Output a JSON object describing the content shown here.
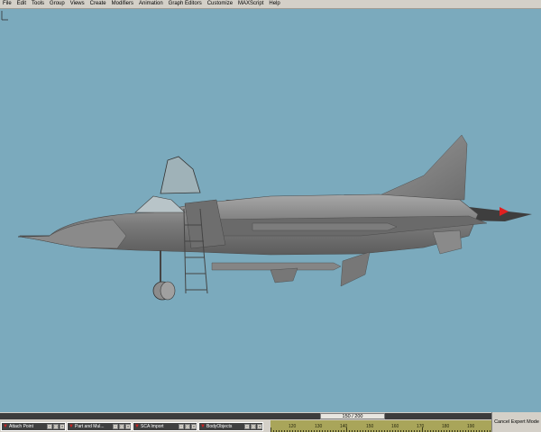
{
  "menu": {
    "items": [
      "File",
      "Edit",
      "Tools",
      "Group",
      "Views",
      "Create",
      "Modifiers",
      "Animation",
      "Graph Editors",
      "Customize",
      "MAXScript",
      "Help"
    ]
  },
  "viewport": {
    "background_color": "#7baabd",
    "object": "aircraft-model"
  },
  "timeline": {
    "frame_label": "150 / 200",
    "ruler_labels": [
      "120",
      "130",
      "140",
      "150",
      "160",
      "170",
      "180",
      "190"
    ]
  },
  "taskbar": {
    "windows": [
      {
        "label": "Attach Point"
      },
      {
        "label": "Part and Mul..."
      },
      {
        "label": "SCA Import"
      },
      {
        "label": "BodyObjects"
      }
    ]
  },
  "expert_button": {
    "label": "Cancel Expert Mode"
  }
}
